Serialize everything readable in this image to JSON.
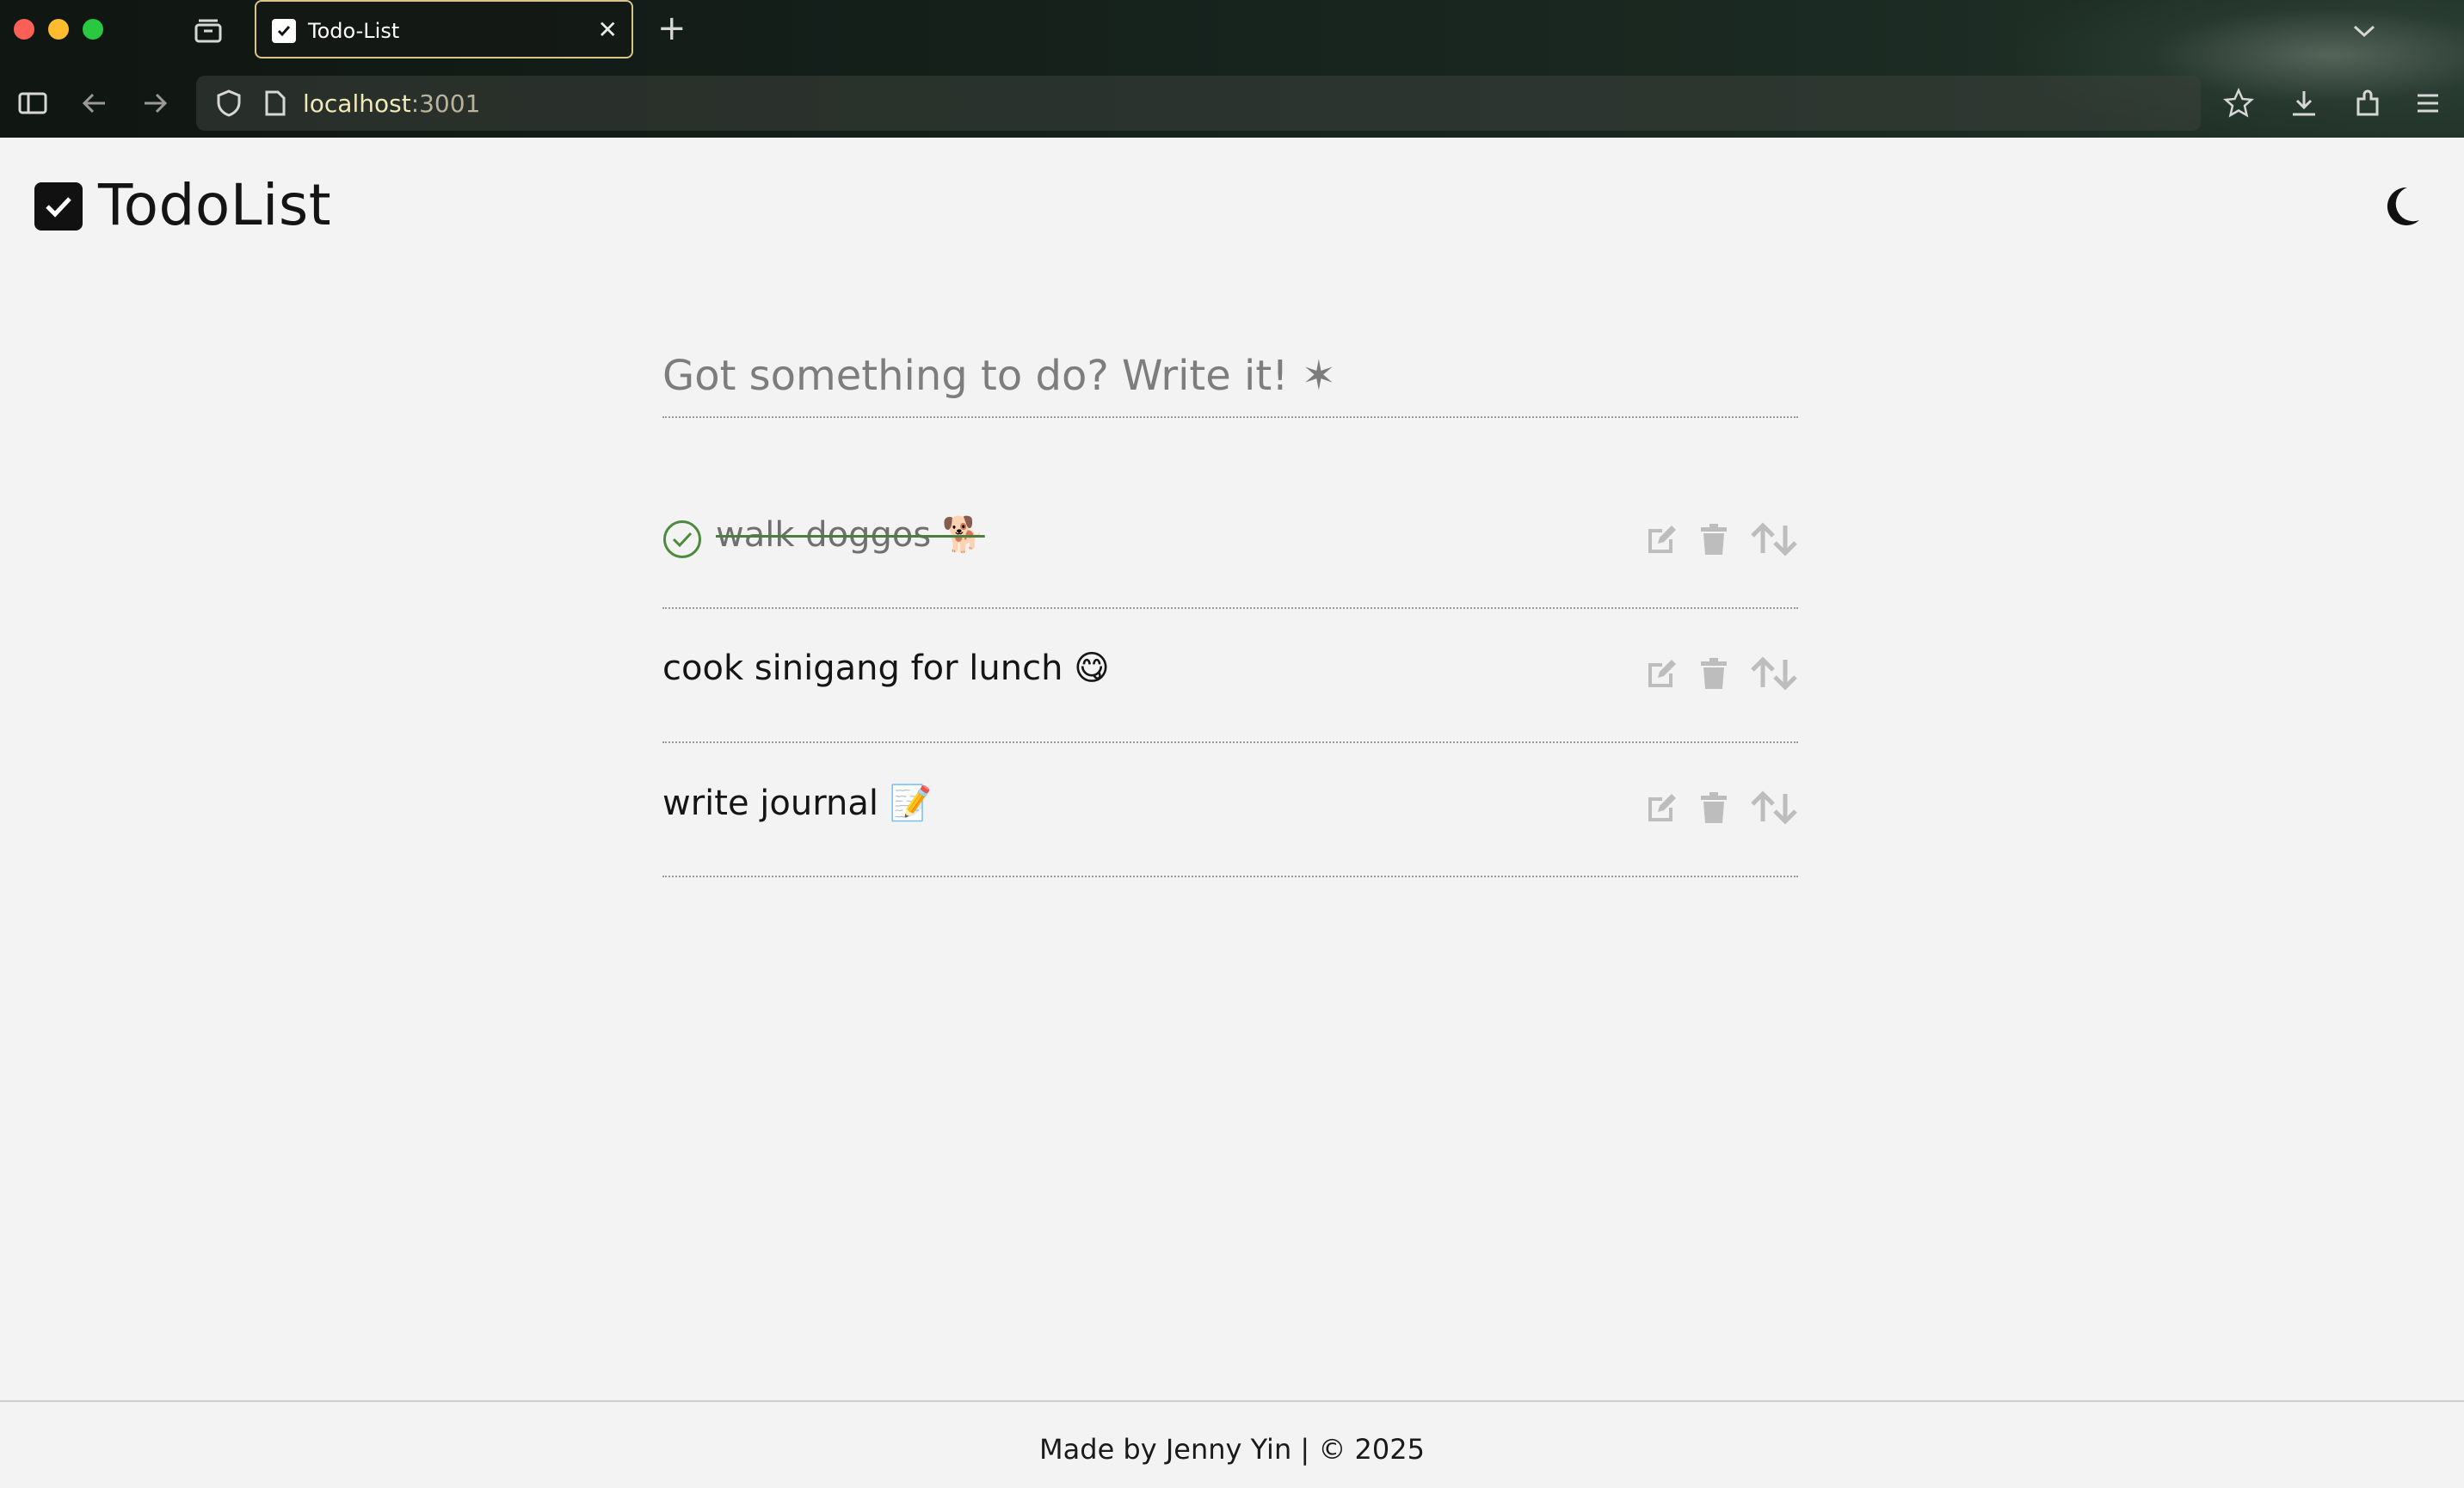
{
  "browser": {
    "tab_title": "Todo-List",
    "tab_close": "✕",
    "new_tab": "+",
    "url_host": "localhost",
    "url_port": ":3001"
  },
  "app": {
    "title": "TodoList",
    "input_placeholder": "Got something to do? Write it! ✶"
  },
  "todos": [
    {
      "text": "walk doggos 🐕",
      "completed": true
    },
    {
      "text": "cook sinigang for lunch 😋",
      "completed": false
    },
    {
      "text": "write journal 📝",
      "completed": false
    }
  ],
  "footer": {
    "text": "Made by Jenny Yin | © 2025"
  },
  "colors": {
    "accent_done": "#4d8a3c",
    "action_icon": "#bdbdbd",
    "background": "#f3f3f3"
  }
}
